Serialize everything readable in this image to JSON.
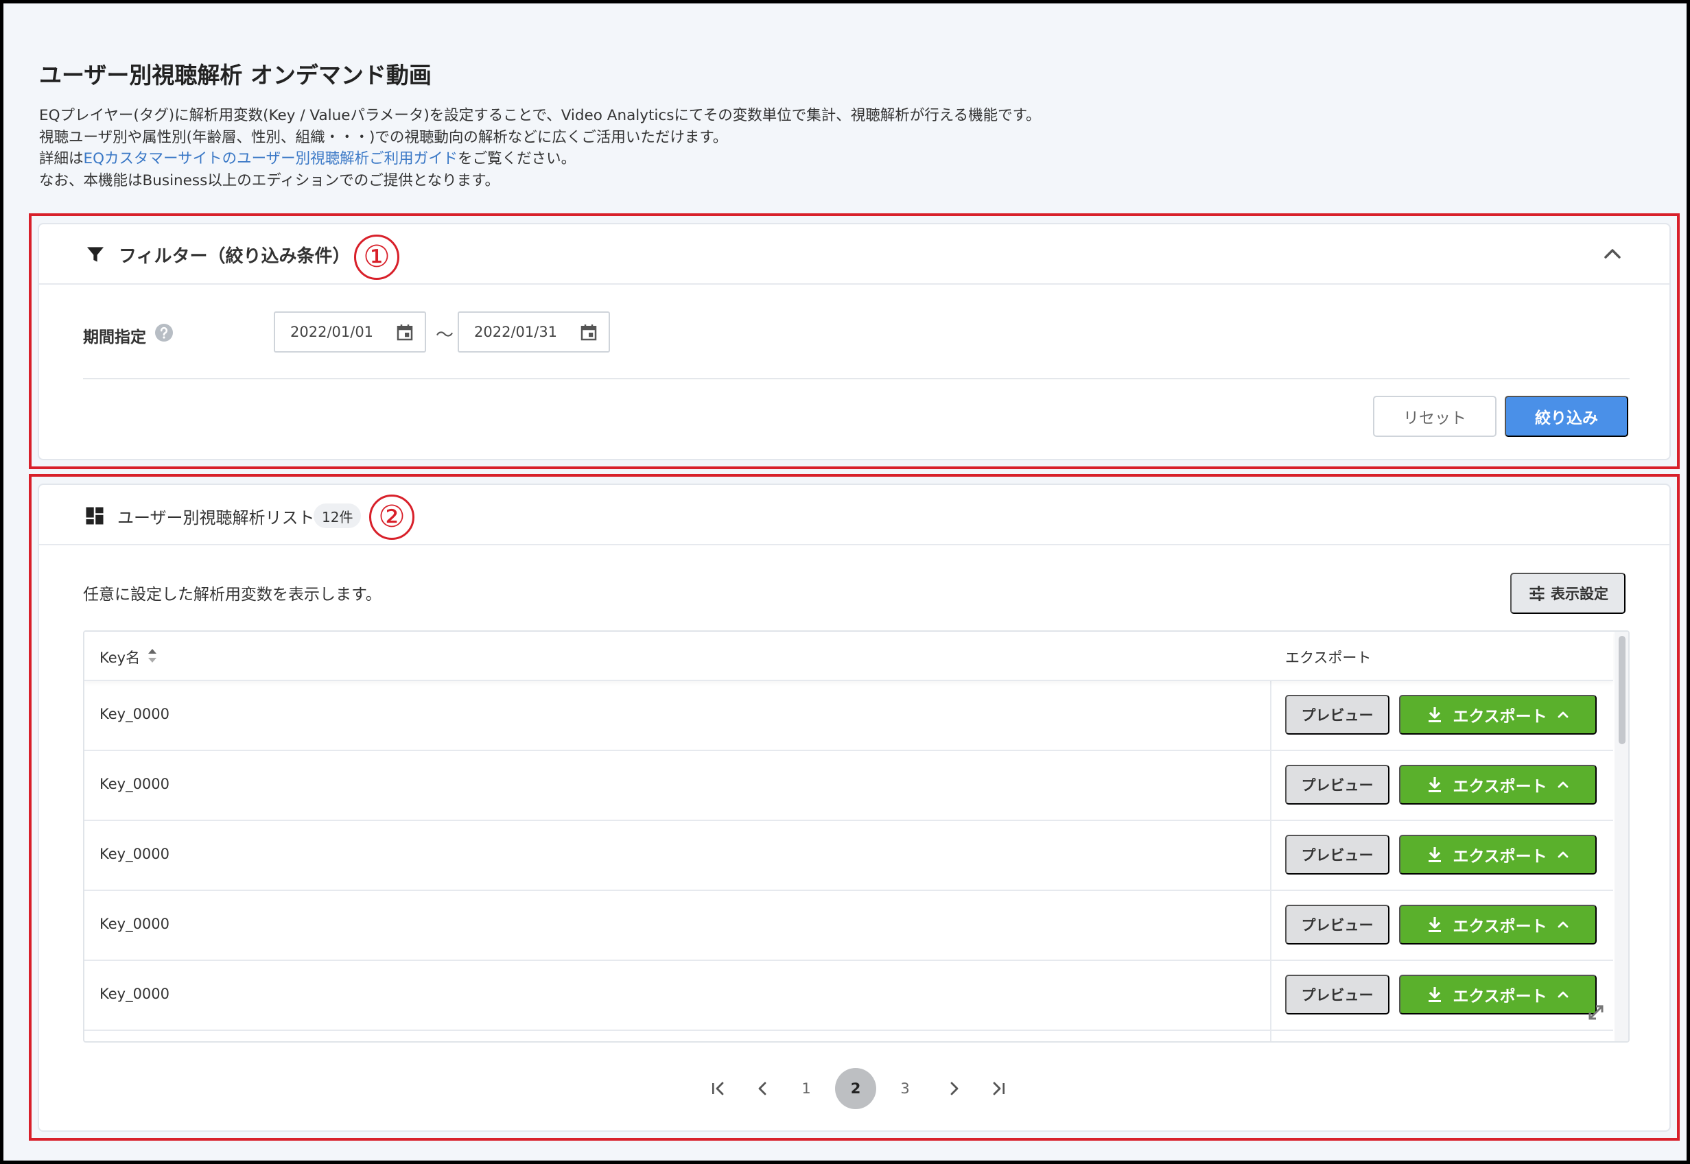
{
  "page": {
    "title": "ユーザー別視聴解析 オンデマンド動画",
    "description": {
      "line1": "EQプレイヤー(タグ)に解析用変数(Key / Valueパラメータ)を設定することで、Video Analyticsにてその変数単位で集計、視聴解析が行える機能です。",
      "line2": "視聴ユーザ別や属性別(年齢層、性別、組織・・・)での視聴動向の解析などに広くご活用いただけます。",
      "line3_prefix": "詳細は",
      "line3_link": "EQカスタマーサイトのユーザー別視聴解析ご利用ガイド",
      "line3_suffix": "をご覧ください。",
      "line4": "なお、本機能はBusiness以上のエディションでのご提供となります。"
    }
  },
  "annotations": {
    "one": "①",
    "two": "②"
  },
  "filter": {
    "title": "フィルター（絞り込み条件）",
    "period_label": "期間指定",
    "date_from": "2022/01/01",
    "date_separator": "～",
    "date_to": "2022/01/31",
    "reset_label": "リセット",
    "apply_label": "絞り込み"
  },
  "list": {
    "title": "ユーザー別視聴解析リスト",
    "count": "12件",
    "description": "任意に設定した解析用変数を表示します。",
    "display_settings_label": "表示設定",
    "columns": {
      "key": "Key名",
      "export": "エクスポート"
    },
    "rows": [
      {
        "key": "Key_0000"
      },
      {
        "key": "Key_0000"
      },
      {
        "key": "Key_0000"
      },
      {
        "key": "Key_0000"
      },
      {
        "key": "Key_0000"
      }
    ],
    "preview_label": "プレビュー",
    "export_label": "エクスポート"
  },
  "pagination": {
    "pages": [
      "1",
      "2",
      "3"
    ],
    "current": "2"
  },
  "colors": {
    "primary": "#4a90e8",
    "export_green": "#5ab02c",
    "annotation_red": "#d8202a",
    "link": "#3a78c6"
  }
}
